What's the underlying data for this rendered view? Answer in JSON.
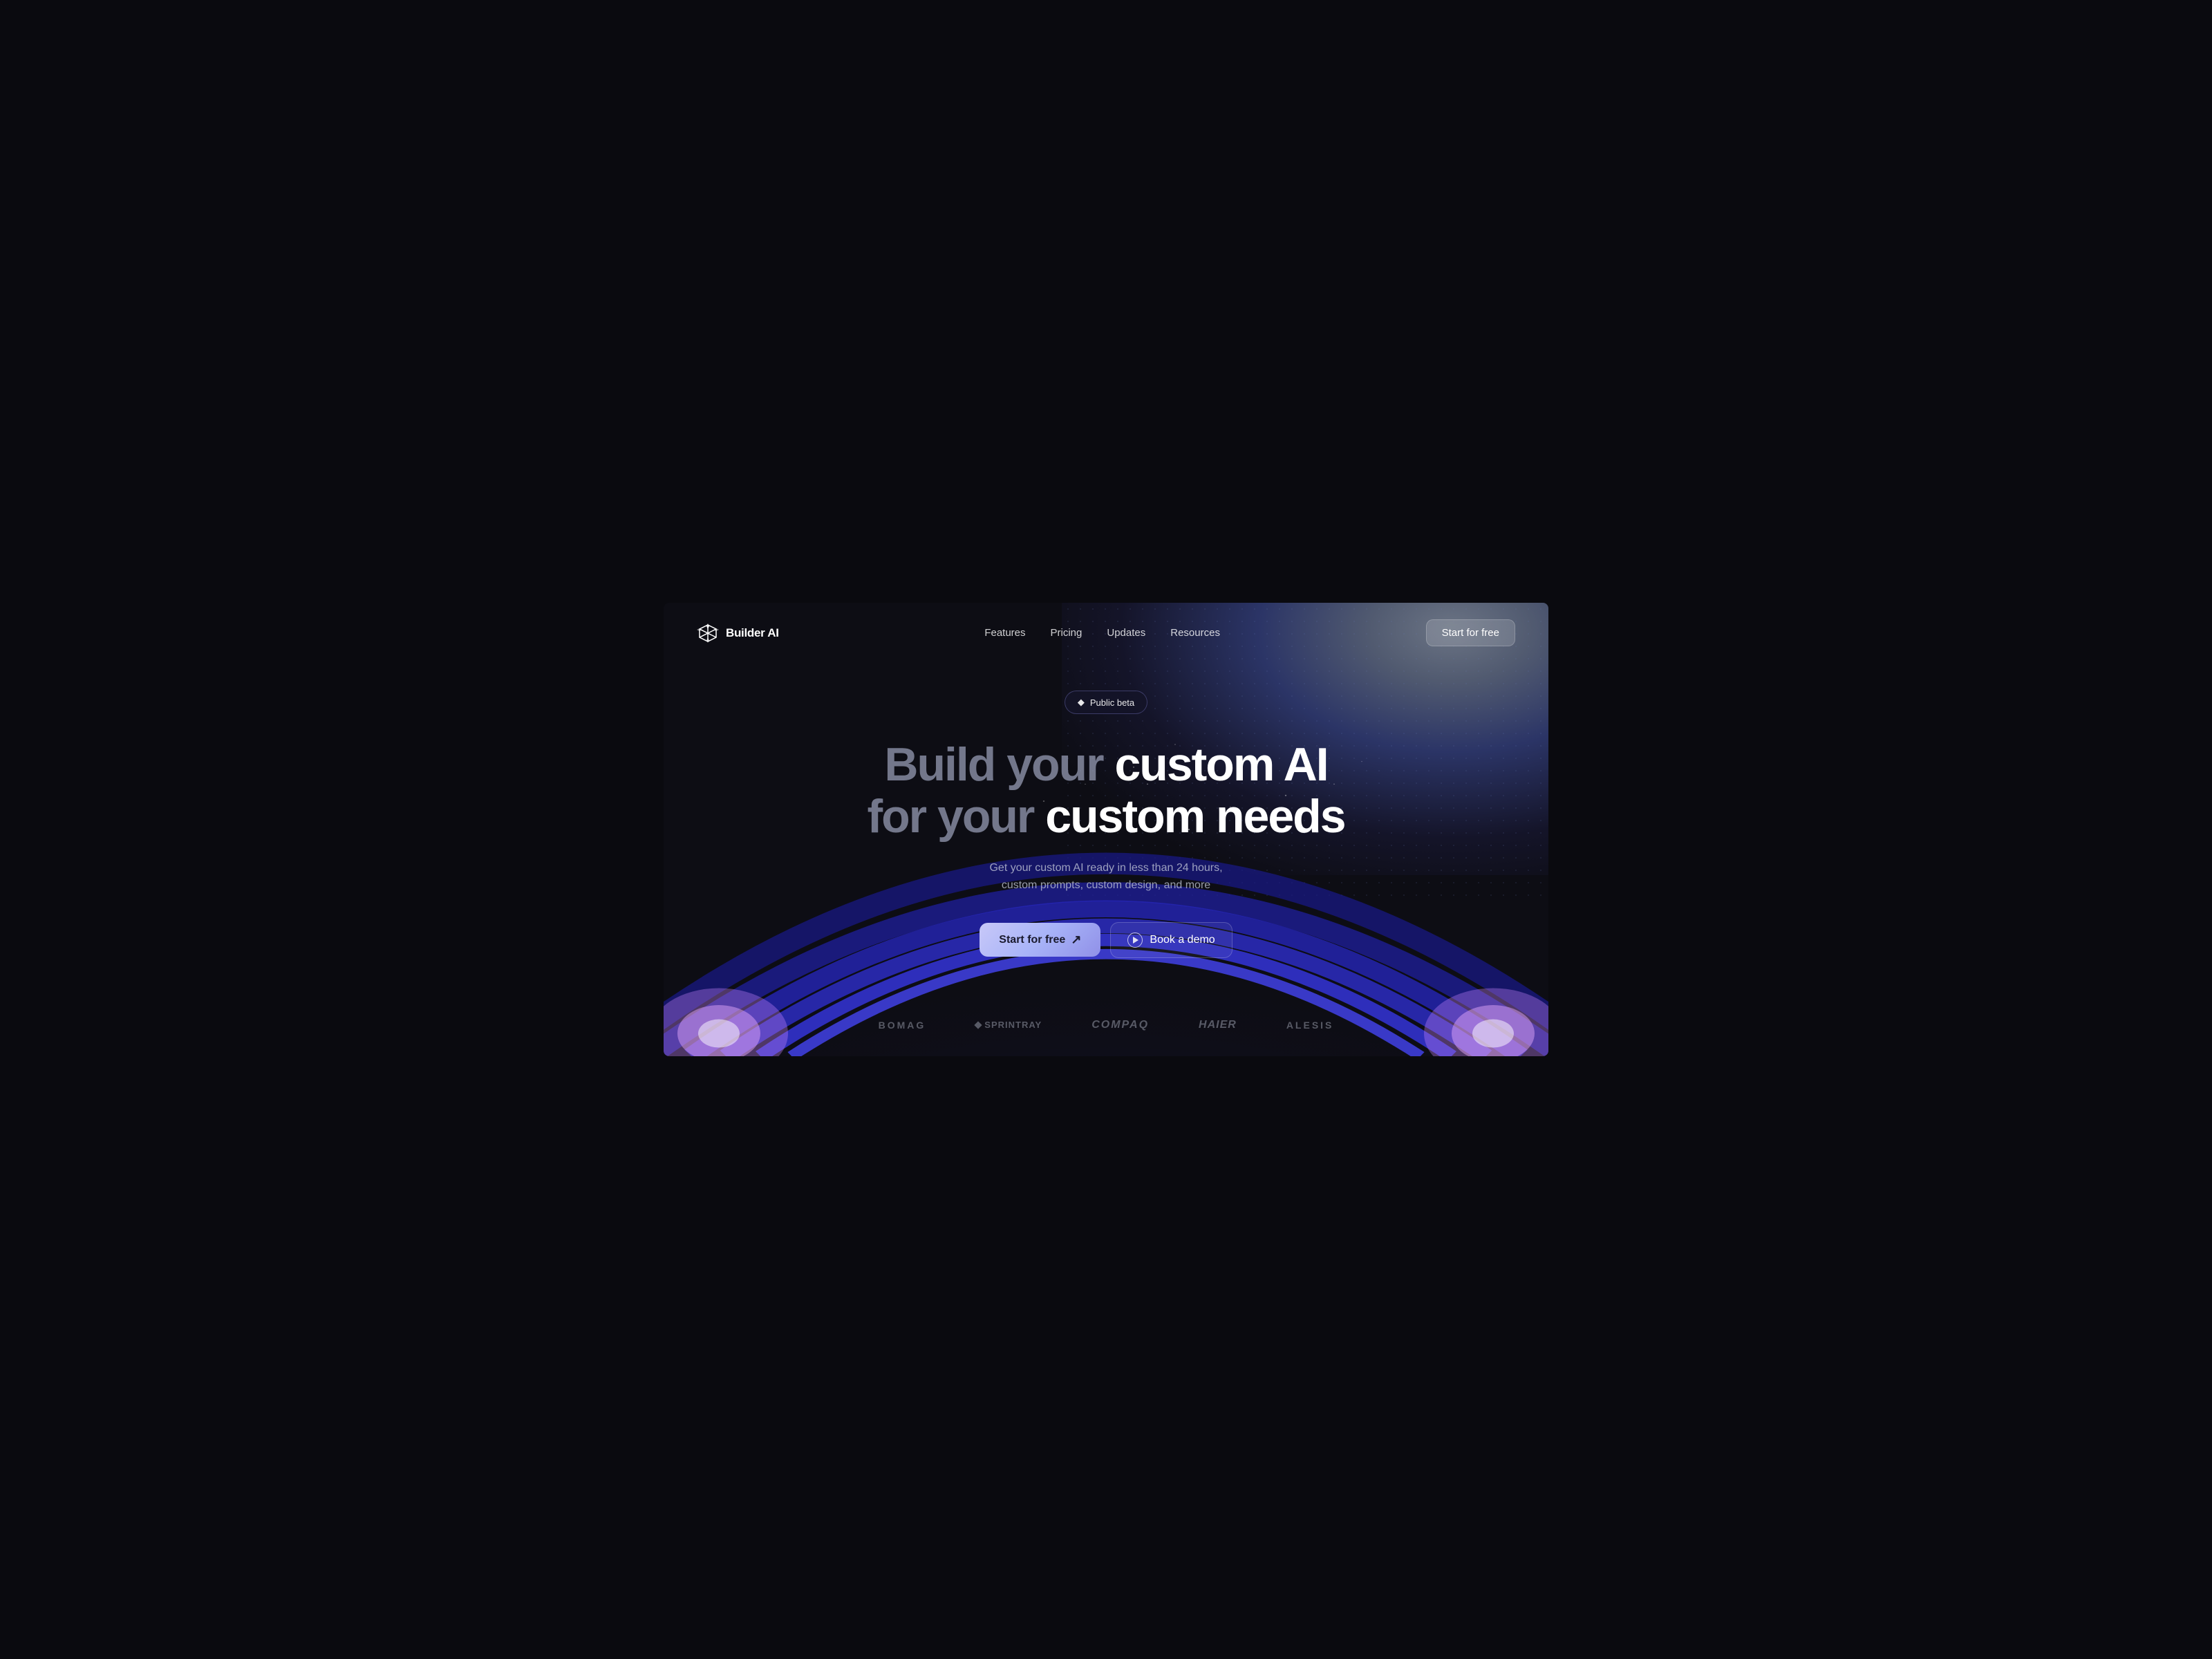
{
  "meta": {
    "title": "Builder AI"
  },
  "nav": {
    "logo_text": "Builder AI",
    "links": [
      {
        "id": "features",
        "label": "Features"
      },
      {
        "id": "pricing",
        "label": "Pricing"
      },
      {
        "id": "updates",
        "label": "Updates"
      },
      {
        "id": "resources",
        "label": "Resources"
      }
    ],
    "cta_label": "Start for free"
  },
  "hero": {
    "badge_text": "Public beta",
    "headline_line1_muted": "Build your",
    "headline_line1_bright": "custom AI",
    "headline_line2_muted": "for your",
    "headline_line2_bright": "custom needs",
    "subtext": "Get your custom AI ready in less than 24 hours, custom prompts, custom design, and more",
    "btn_primary_label": "Start for free",
    "btn_primary_arrow": "↗",
    "btn_secondary_label": "Book a demo"
  },
  "logos": [
    {
      "id": "bomag",
      "label": "BOMAG",
      "style_class": "bomag"
    },
    {
      "id": "sprintray",
      "label": "SprintRay",
      "style_class": "sprintray"
    },
    {
      "id": "compaq",
      "label": "COMPAQ",
      "style_class": "compaq"
    },
    {
      "id": "haier",
      "label": "Haier",
      "style_class": "haier"
    },
    {
      "id": "alesis",
      "label": "ALESIS",
      "style_class": "alesis"
    }
  ],
  "colors": {
    "background": "#0d0d14",
    "accent_gradient_start": "#c8c8f8",
    "accent_gradient_end": "#9090e8",
    "arc_color_1": "#1a1a6e",
    "arc_color_2": "#2222aa",
    "arc_color_3": "#3333cc",
    "arc_highlight": "#8855ff"
  }
}
